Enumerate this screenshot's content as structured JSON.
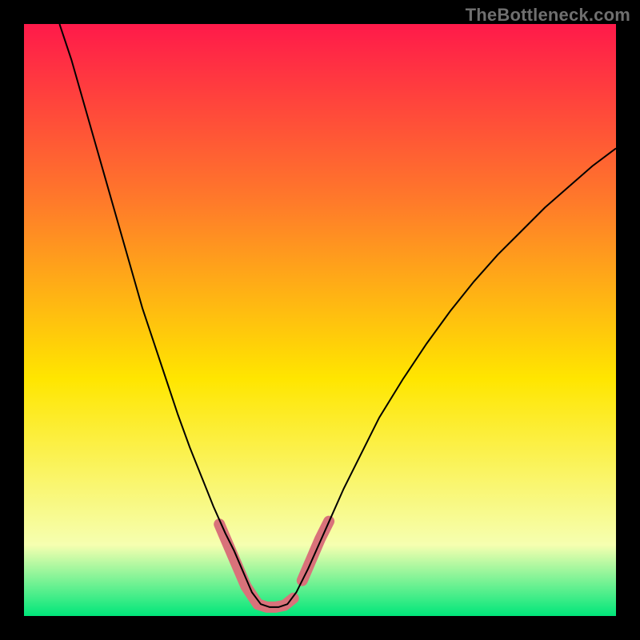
{
  "watermark": "TheBottleneck.com",
  "chart_data": {
    "type": "line",
    "title": "",
    "xlabel": "",
    "ylabel": "",
    "xlim": [
      0,
      1
    ],
    "ylim": [
      0,
      1
    ],
    "gradient_colors": {
      "top": "#ff1a4a",
      "upper_mid": "#ff7a2a",
      "mid": "#ffe600",
      "lower": "#f6ffb0",
      "bottom": "#00e67a"
    },
    "series": [
      {
        "name": "curve",
        "stroke": "#000000",
        "stroke_width": 2,
        "x": [
          0.06,
          0.08,
          0.1,
          0.12,
          0.14,
          0.16,
          0.18,
          0.2,
          0.22,
          0.24,
          0.26,
          0.28,
          0.3,
          0.32,
          0.34,
          0.355,
          0.37,
          0.385,
          0.4,
          0.415,
          0.43,
          0.445,
          0.46,
          0.48,
          0.5,
          0.52,
          0.54,
          0.56,
          0.58,
          0.6,
          0.64,
          0.68,
          0.72,
          0.76,
          0.8,
          0.84,
          0.88,
          0.92,
          0.96,
          1.0
        ],
        "y": [
          1.0,
          0.94,
          0.87,
          0.8,
          0.73,
          0.66,
          0.59,
          0.52,
          0.46,
          0.4,
          0.34,
          0.285,
          0.235,
          0.185,
          0.14,
          0.11,
          0.075,
          0.04,
          0.02,
          0.015,
          0.015,
          0.02,
          0.04,
          0.08,
          0.125,
          0.17,
          0.215,
          0.255,
          0.295,
          0.335,
          0.4,
          0.46,
          0.515,
          0.565,
          0.61,
          0.65,
          0.69,
          0.725,
          0.76,
          0.79
        ]
      },
      {
        "name": "highlight-left",
        "stroke": "#d9727a",
        "stroke_width": 14,
        "linecap": "round",
        "x": [
          0.33,
          0.345,
          0.36,
          0.375,
          0.395
        ],
        "y": [
          0.155,
          0.12,
          0.085,
          0.05,
          0.02
        ]
      },
      {
        "name": "highlight-bottom",
        "stroke": "#d9727a",
        "stroke_width": 14,
        "linecap": "round",
        "x": [
          0.395,
          0.41,
          0.425,
          0.44,
          0.455
        ],
        "y": [
          0.02,
          0.015,
          0.015,
          0.018,
          0.03
        ]
      },
      {
        "name": "highlight-right",
        "stroke": "#d9727a",
        "stroke_width": 14,
        "linecap": "round",
        "x": [
          0.47,
          0.485,
          0.5,
          0.515
        ],
        "y": [
          0.06,
          0.095,
          0.13,
          0.16
        ]
      }
    ]
  }
}
